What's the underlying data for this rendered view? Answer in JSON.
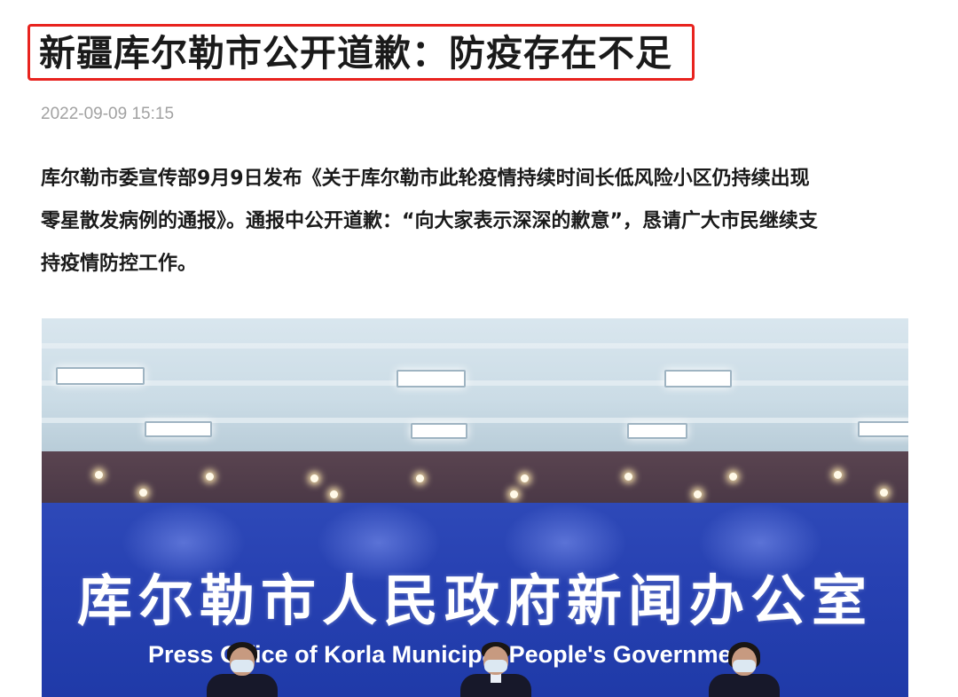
{
  "article": {
    "title": "新疆库尔勒市公开道歉：防疫存在不足",
    "timestamp": "2022-09-09 15:15",
    "lead_lines": [
      "库尔勒市委宣传部9月9日发布《关于库尔勒市此轮疫情持续时间长低风险小区仍持续出现",
      "零星散发病例的通报》。通报中公开道歉：“向大家表示深深的歉意”，恳请广大市民继续支",
      "持疫情防控工作。"
    ],
    "title_highlight_color": "#e8231f"
  },
  "photo": {
    "banner_cn": "库尔勒市人民政府新闻办公室",
    "banner_en": "Press Office of Korla Municipal People's Government"
  }
}
